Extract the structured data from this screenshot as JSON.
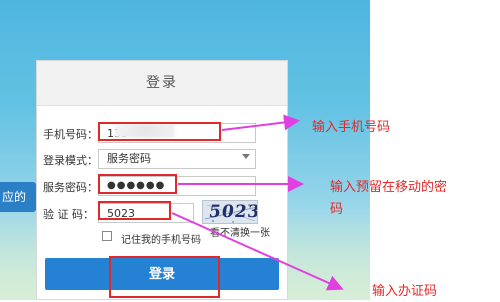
{
  "side_tab": {
    "label": "应的"
  },
  "panel": {
    "title": "登录"
  },
  "form": {
    "phone_label": "手机号码：",
    "phone_value": "139",
    "login_mode_label": "登录模式：",
    "login_mode_value": "服务密码",
    "service_pwd_label": "服务密码：",
    "service_pwd_value": "●●●●●●",
    "captcha_label": "验 证 码：",
    "captcha_value": "5023",
    "captcha_image_text": "5023",
    "captcha_refresh": "看不清换一张",
    "remember_label": "记住我的手机号码",
    "login_button": "登录"
  },
  "annotations": {
    "phone": "输入手机号码",
    "password_line1": "输入预留在移动的密",
    "password_line2": "码",
    "captcha": "输入办证码"
  },
  "colors": {
    "annotation": "#e02a2a",
    "arrow": "#e040e0",
    "button": "#2581d3"
  }
}
